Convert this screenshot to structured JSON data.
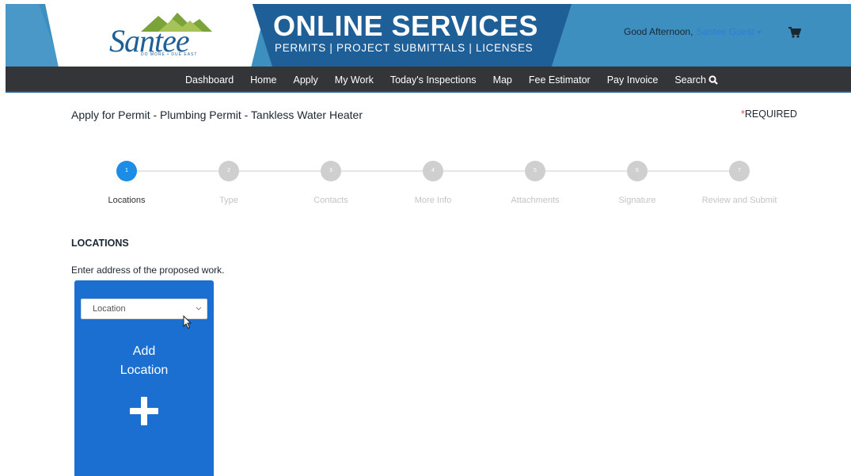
{
  "header": {
    "logo_text": "Santee",
    "logo_tagline": "DO MORE • DUE EAST",
    "title": "ONLINE SERVICES",
    "subtitle": "PERMITS | PROJECT SUBMITTALS | LICENSES",
    "greeting": "Good Afternoon,",
    "user_name": "Santee Guest",
    "cart_icon": "shopping-cart-icon"
  },
  "nav": {
    "items": [
      {
        "label": "Dashboard"
      },
      {
        "label": "Home"
      },
      {
        "label": "Apply"
      },
      {
        "label": "My Work"
      },
      {
        "label": "Today's Inspections"
      },
      {
        "label": "Map"
      },
      {
        "label": "Fee Estimator"
      },
      {
        "label": "Pay Invoice"
      },
      {
        "label": "Search"
      }
    ],
    "search_icon": "search-icon"
  },
  "page": {
    "title": "Apply for Permit - Plumbing Permit - Tankless Water Heater",
    "required_star": "*",
    "required_label": "REQUIRED"
  },
  "steps": [
    {
      "number": "1",
      "label": "Locations",
      "active": true
    },
    {
      "number": "2",
      "label": "Type",
      "active": false
    },
    {
      "number": "3",
      "label": "Contacts",
      "active": false
    },
    {
      "number": "4",
      "label": "More Info",
      "active": false
    },
    {
      "number": "5",
      "label": "Attachments",
      "active": false
    },
    {
      "number": "6",
      "label": "Signature",
      "active": false
    },
    {
      "number": "7",
      "label": "Review and Submit",
      "active": false
    }
  ],
  "locations": {
    "heading": "LOCATIONS",
    "instruction": "Enter address of the proposed work.",
    "select_value": "Location",
    "card_line1": "Add",
    "card_line2": "Location"
  },
  "colors": {
    "banner": "#3d8fc0",
    "banner_dark": "#1e5f97",
    "nav_bg": "#333538",
    "accent": "#1b6fd1",
    "step_active": "#1d8ce6",
    "step_inactive": "#cfcfcf"
  }
}
